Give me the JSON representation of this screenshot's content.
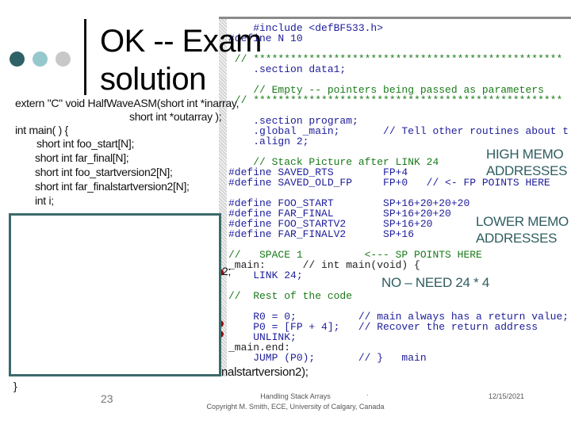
{
  "title": {
    "line1": "OK -- Exam",
    "line2": "solution"
  },
  "colors": {
    "dot1": "#2e6266",
    "dot2": "#95c8cd",
    "dot3": "#c8c8c8",
    "accent": "#2f5d60",
    "comment": "#1a7a1a",
    "keyword": "#14148a"
  },
  "c_code": {
    "extern": "extern \"C\" void HalfWaveASM(short int *inarray,",
    "extern2": "short int *outarray );",
    "main": "int main( ) {",
    "decl1": "short int foo_start[N];",
    "decl2": "short int far_final[N];",
    "decl3": "short int foo_startversion2[N];",
    "decl4": "short int far_finalstartversion2[N];",
    "decl5": "int i;",
    "partial1": "2;",
    "partial2": "nalstartversion2);",
    "close": "}"
  },
  "asm": [
    {
      "text": "    #include <defBF533.h>",
      "cls": "k"
    },
    {
      "text": "#define N 10",
      "cls": "k"
    },
    {
      "text": "",
      "cls": "k"
    },
    {
      "text": " // **************************************************",
      "cls": "c"
    },
    {
      "text": "    .section data1;",
      "cls": "k"
    },
    {
      "text": "",
      "cls": "k"
    },
    {
      "text": "    // Empty -- pointers being passed as parameters",
      "cls": "c"
    },
    {
      "text": " // **************************************************",
      "cls": "c"
    },
    {
      "text": "",
      "cls": "k"
    },
    {
      "text": "    .section program;",
      "cls": "k"
    },
    {
      "text": "    .global _main;       // Tell other routines about t",
      "cls": "k"
    },
    {
      "text": "    .align 2;",
      "cls": "k"
    },
    {
      "text": "",
      "cls": "k"
    },
    {
      "text": "    // Stack Picture after LINK 24",
      "cls": "c"
    },
    {
      "text": "#define SAVED_RTS        FP+4",
      "cls": "k"
    },
    {
      "text": "#define SAVED_OLD_FP     FP+0   // <- FP POINTS HERE",
      "cls": "k"
    },
    {
      "text": "",
      "cls": "k"
    },
    {
      "text": "#define FOO_START        SP+16+20+20+20",
      "cls": "k"
    },
    {
      "text": "#define FAR_FINAL        SP+16+20+20",
      "cls": "k"
    },
    {
      "text": "#define FOO_STARTV2      SP+16+20",
      "cls": "k"
    },
    {
      "text": "#define FAR_FINALV2      SP+16",
      "cls": "k"
    },
    {
      "text": "",
      "cls": "k"
    },
    {
      "text": "//   SPACE 1          <--- SP POINTS HERE",
      "cls": "c"
    },
    {
      "text": "_main:      // int main(void) {",
      "cls": "t"
    },
    {
      "text": "    LINK 24;",
      "cls": "k"
    },
    {
      "text": "",
      "cls": "k"
    },
    {
      "text": "//  Rest of the code",
      "cls": "c"
    },
    {
      "text": "",
      "cls": "k"
    },
    {
      "text": "    R0 = 0;          // main always has a return value;",
      "cls": "k"
    },
    {
      "text": "    P0 = [FP + 4];   // Recover the return address",
      "cls": "k"
    },
    {
      "text": "    UNLINK;",
      "cls": "k"
    },
    {
      "text": "_main.end:",
      "cls": "t"
    },
    {
      "text": "    JUMP (P0);       // }   main",
      "cls": "k"
    }
  ],
  "notes": {
    "high1": "HIGH MEMO",
    "high2": "ADDRESSES",
    "low1": "LOWER MEMO",
    "low2": "ADDRESSES",
    "need": "NO – NEED 24 * 4"
  },
  "footer": {
    "page": "23",
    "title": "Handling Stack Arrays",
    "copyright": "Copyright M. Smith, ECE, University of Calgary, Canada",
    "date": "12/15/2021",
    "dot": "."
  }
}
